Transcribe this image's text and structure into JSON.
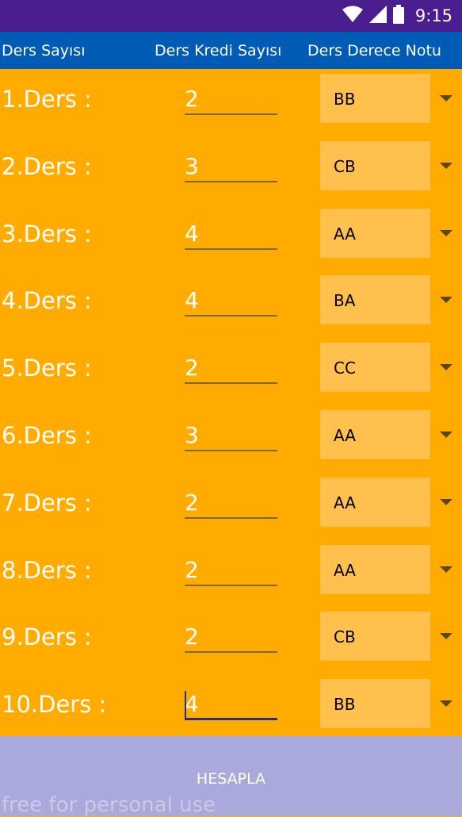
{
  "status": {
    "time": "9:15"
  },
  "header": {
    "col1": "Ders Sayısı",
    "col2": "Ders Kredi Sayısı",
    "col3": "Ders Derece Notu"
  },
  "rows": [
    {
      "label": "1.Ders :",
      "credit": "2",
      "grade": "BB"
    },
    {
      "label": "2.Ders :",
      "credit": "3",
      "grade": "CB"
    },
    {
      "label": "3.Ders :",
      "credit": "4",
      "grade": "AA"
    },
    {
      "label": "4.Ders :",
      "credit": "4",
      "grade": "BA"
    },
    {
      "label": "5.Ders :",
      "credit": "2",
      "grade": "CC"
    },
    {
      "label": "6.Ders :",
      "credit": "3",
      "grade": "AA"
    },
    {
      "label": "7.Ders :",
      "credit": "2",
      "grade": "AA"
    },
    {
      "label": "8.Ders :",
      "credit": "2",
      "grade": "AA"
    },
    {
      "label": "9.Ders :",
      "credit": "2",
      "grade": "CB"
    },
    {
      "label": "10.Ders :",
      "credit": "4",
      "grade": "BB"
    }
  ],
  "button": {
    "label": "HESAPLA"
  },
  "watermark": "free for personal use",
  "colors": {
    "status_bar": "#4A1E8E",
    "header": "#005BB5",
    "background": "#FFAB00",
    "spinner": "#FFC04D",
    "button": "#A9A9DC"
  }
}
